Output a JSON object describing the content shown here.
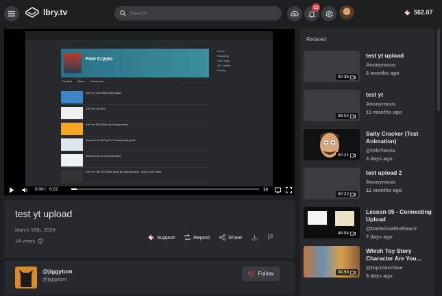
{
  "header": {
    "brand": "lbry.tv",
    "search_placeholder": "Search",
    "notification_count": "12",
    "balance": "562.07"
  },
  "player": {
    "time_current": "0:00",
    "time_total": "0:22",
    "speed": "1x",
    "progress": 0.03,
    "embedded": {
      "channel_title": "Free Crypto",
      "tabs": [
        "Content",
        "About",
        "Comments"
      ],
      "rows": [
        "Get Free 1457 MESH ($90 value)",
        "Get Free 163 HEX",
        "Get Free 998 Tokens By Joining Airdrop",
        "Receive Free DLG (LD 174 value) Staking Slot",
        "Receive Free 10 XVS (224 value)",
        "Get Free 750 XVS ($298 value) By Joining Airdrop - Only 10,000 Users"
      ],
      "side_links": [
        "Home",
        "Following",
        "Your Tags",
        "All Content",
        "Library"
      ]
    }
  },
  "video": {
    "title": "test yt upload",
    "date": "March 10th, 2020",
    "views": "14 views",
    "actions": {
      "support": "Support",
      "repost": "Repost",
      "share": "Share"
    }
  },
  "channel": {
    "name": "@jiggytom",
    "handle": "@jiggytom",
    "follow_label": "Follow"
  },
  "related": {
    "heading": "Related",
    "items": [
      {
        "title": "test yt upload",
        "channel": "Anonymous",
        "age": "6 months ago",
        "duration": "00:35"
      },
      {
        "title": "test yt",
        "channel": "Anonymous",
        "age": "11 months ago",
        "duration": "08:02"
      },
      {
        "title": "Salty Cracker (Test Animation)",
        "channel": "@InfoToons",
        "age": "3 days ago",
        "duration": "00:21"
      },
      {
        "title": "test upload 2",
        "channel": "Anonymous",
        "age": "11 months ago",
        "duration": "00:22"
      },
      {
        "title": "Lesson 05 - Connecting Upload",
        "channel": "@DarkritualSoftware",
        "age": "7 days ago",
        "duration": "48:04"
      },
      {
        "title": "Which Toy Story Character Are You...",
        "channel": "@top10archive",
        "age": "8 days ago",
        "duration": "04:58"
      }
    ]
  },
  "colors": {
    "background": "#1e1f21",
    "card": "#27292d",
    "badge": "#e63946",
    "follow_heart": "#e63946"
  }
}
